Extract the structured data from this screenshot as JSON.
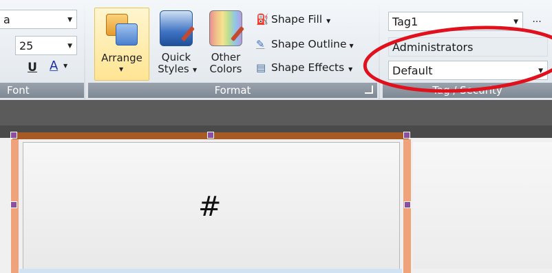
{
  "font_group": {
    "font_name_partial": "a",
    "font_size": "25",
    "underline_label": "U",
    "font_color_label": "A",
    "label": "Font"
  },
  "format_group": {
    "arrange_label": "Arrange",
    "quick_styles_line1": "Quick",
    "quick_styles_line2": "Styles",
    "other_colors_line1": "Other",
    "other_colors_line2": "Colors",
    "shape_fill": "Shape Fill",
    "shape_outline": "Shape Outline",
    "shape_effects": "Shape Effects",
    "label": "Format"
  },
  "tag_group": {
    "tag_value": "Tag1",
    "more_label": "...",
    "security_value": "Administrators",
    "default_value": "Default",
    "label": "Tag / Security"
  },
  "canvas": {
    "cell_text": "#"
  },
  "colors": {
    "selection_bar": "#a85a25",
    "side_bar": "#f0a27a",
    "handle": "#8c4fa0",
    "annotation": "#e0101d"
  }
}
